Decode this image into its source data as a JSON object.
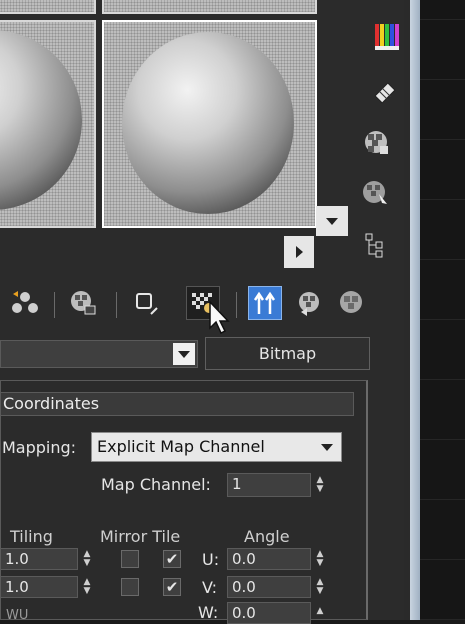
{
  "toolbar": {
    "tooltip_label": "Bitmap"
  },
  "coordinates": {
    "title": "Coordinates",
    "mapping_label": "Mapping:",
    "mapping_value": "Explicit Map Channel",
    "map_channel_label": "Map Channel:",
    "map_channel_value": "1"
  },
  "table": {
    "tiling_header": "Tiling",
    "mirror_tile_header": "Mirror Tile",
    "angle_header": "Angle",
    "u_label": "U:",
    "v_label": "V:",
    "w_label": "W:",
    "w_tiling_label": "WU",
    "rows": [
      {
        "tiling": "1.0",
        "mirror": false,
        "tile": true,
        "angle": "0.0"
      },
      {
        "tiling": "1.0",
        "mirror": false,
        "tile": true,
        "angle": "0.0"
      }
    ],
    "w_angle": "0.0"
  },
  "icons": {
    "color_bars": "color-bars-icon",
    "eyedropper": "eyedropper-icon",
    "checker": "checker-icon"
  },
  "colors": {
    "accent": "#3a7bd5",
    "panel": "#2b2b2b",
    "field": "#3f3f3f"
  }
}
